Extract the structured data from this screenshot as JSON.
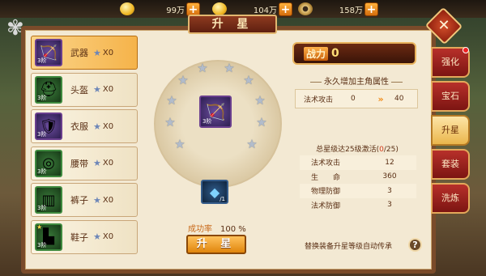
{
  "currencies": [
    {
      "icon": "gold-ingot-icon",
      "value": "99万"
    },
    {
      "icon": "gold-ingot-icon",
      "value": "104万"
    },
    {
      "icon": "coin-icon",
      "value": "158万"
    }
  ],
  "title": "升 星",
  "close_label": "✕",
  "equipment": [
    {
      "name": "武器",
      "level": "3阶",
      "count": "X0",
      "icon": "bow-icon",
      "selected": true
    },
    {
      "name": "头盔",
      "level": "3阶",
      "count": "X0",
      "icon": "helmet-icon"
    },
    {
      "name": "衣服",
      "level": "3阶",
      "count": "X0",
      "icon": "armor-icon"
    },
    {
      "name": "腰带",
      "level": "3阶",
      "count": "X0",
      "icon": "belt-icon"
    },
    {
      "name": "裤子",
      "level": "3阶",
      "count": "X0",
      "icon": "pants-icon"
    },
    {
      "name": "鞋子",
      "level": "3阶",
      "count": "X0",
      "icon": "boots-icon"
    }
  ],
  "center_item": {
    "level": "3阶",
    "icon": "bow-icon"
  },
  "material": {
    "count": "/1",
    "icon": "blue-gem-icon"
  },
  "success": {
    "label": "成功率",
    "value": "100 %"
  },
  "upgrade_button": "升 星",
  "power": {
    "label": "战力",
    "value": "0"
  },
  "permanent_label": "永久增加主角属性",
  "permanent_attr": {
    "name": "法术攻击",
    "from": "0",
    "to": "40"
  },
  "total": {
    "prefix": "总星级达25级激活(",
    "current": "0",
    "suffix": "/25)"
  },
  "stats": [
    {
      "name": "法术攻击",
      "value": "12"
    },
    {
      "name": "生　　命",
      "value": "360"
    },
    {
      "name": "物理防御",
      "value": "3"
    },
    {
      "name": "法术防御",
      "value": "3"
    }
  ],
  "footer_text": "替换装备升星等级自动传承",
  "help_label": "?",
  "tabs": [
    {
      "label": "强化"
    },
    {
      "label": "宝石"
    },
    {
      "label": "升星",
      "selected": true
    },
    {
      "label": "套装"
    },
    {
      "label": "洗炼"
    }
  ]
}
